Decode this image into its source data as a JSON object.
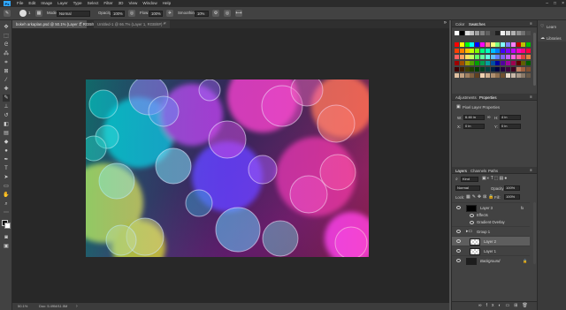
{
  "app": {
    "logo": "Ps"
  },
  "menu": [
    "File",
    "Edit",
    "Image",
    "Layer",
    "Type",
    "Select",
    "Filter",
    "3D",
    "View",
    "Window",
    "Help"
  ],
  "window_controls": {
    "minimize": "–",
    "maximize": "□",
    "close": "×"
  },
  "options": {
    "brush_size": "1",
    "mode_label": "Mode:",
    "mode_value": "Normal",
    "opacity_label": "Opacity:",
    "opacity_value": "100%",
    "flow_label": "Flow:",
    "flow_value": "100%",
    "smoothing_label": "Smoothing:",
    "smoothing_value": "10%"
  },
  "tabs": [
    {
      "label": "bokeh arkaplan.psd @ 50.1% (Layer 1, RGB/8) *",
      "close": "×"
    },
    {
      "label": "Untitled-1 @ 66.7% (Layer 1, RGB/8#) *",
      "close": "×"
    }
  ],
  "status": {
    "zoom": "50.1%",
    "doc": "Doc: 5.49M/11.5M"
  },
  "panels": {
    "color_tabs": [
      "Color",
      "Swatches"
    ],
    "adjust_tabs": [
      "Adjustments",
      "Properties"
    ],
    "properties": {
      "title": "Pixel Layer Properties",
      "w_label": "W:",
      "w_value": "6.46 in",
      "h_label": "H:",
      "h_value": "4 in",
      "x_label": "X:",
      "x_value": "0 in",
      "y_label": "Y:",
      "y_value": "0 in"
    },
    "layers_tabs": [
      "Layers",
      "Channels",
      "Paths"
    ],
    "kind_label": "Kind",
    "blend_mode": "Normal",
    "opacity_label": "Opacity:",
    "opacity_value": "100%",
    "lock_label": "Lock:",
    "fill_label": "Fill:",
    "fill_value": "100%",
    "layers": [
      {
        "name": "Layer 3",
        "fx": "fx"
      },
      {
        "name": "Effects"
      },
      {
        "name": "Gradient Overlay"
      },
      {
        "name": "Group 1"
      },
      {
        "name": "Layer 2"
      },
      {
        "name": "Layer 1"
      },
      {
        "name": "Background"
      }
    ]
  },
  "right_strip": [
    {
      "label": "Learn",
      "icon": "learn-icon"
    },
    {
      "label": "Libraries",
      "icon": "libraries-icon"
    }
  ],
  "colors": {
    "accent": "#31a8ff",
    "panel": "#424242",
    "canvas": "#282828"
  }
}
